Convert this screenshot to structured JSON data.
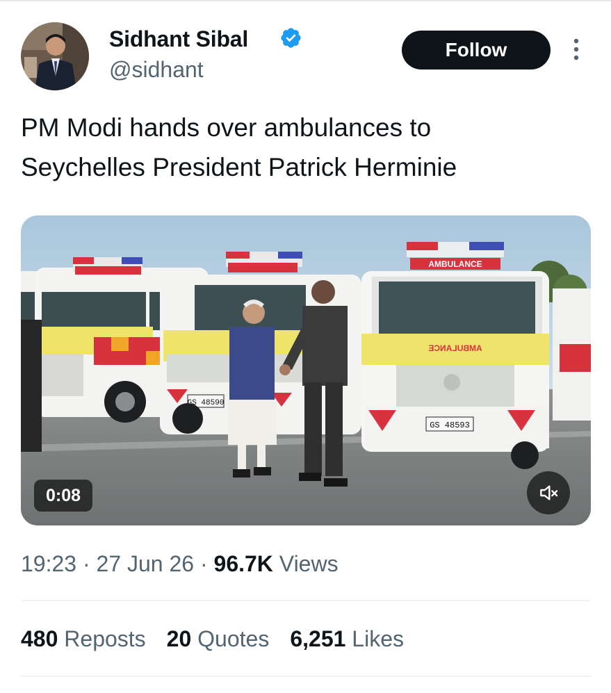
{
  "author": {
    "name": "Sidhant Sibal",
    "handle": "@sidhant",
    "verified_icon": "verified-badge-icon",
    "accent": "#1d9bf0"
  },
  "actions": {
    "follow_label": "Follow",
    "more_icon": "more-vertical-icon"
  },
  "tweet": {
    "text_line1": "PM Modi hands over ambulances to",
    "text_line2": "Seychelles President Patrick Herminie"
  },
  "media": {
    "duration": "0:08",
    "mute_icon": "volume-muted-icon",
    "ambulance_label": "AMBULANCE",
    "ambulance_mirror_label": "AMBULANCE",
    "plate_center": "GS 48593",
    "plate_left": "GS 48590"
  },
  "meta": {
    "time": "19:23",
    "separator": "·",
    "date": "27 Jun 26",
    "views_count": "96.7K",
    "views_label": "Views"
  },
  "stats": {
    "reposts_count": "480",
    "reposts_label": "Reposts",
    "quotes_count": "20",
    "quotes_label": "Quotes",
    "likes_count": "6,251",
    "likes_label": "Likes"
  }
}
